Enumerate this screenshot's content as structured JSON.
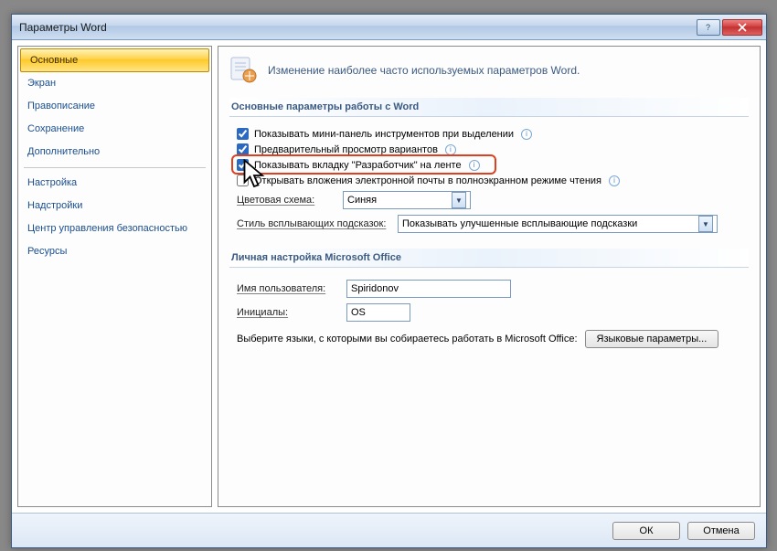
{
  "window": {
    "title": "Параметры Word"
  },
  "sidebar": {
    "items": [
      {
        "label": "Основные",
        "selected": true
      },
      {
        "label": "Экран"
      },
      {
        "label": "Правописание"
      },
      {
        "label": "Сохранение"
      },
      {
        "label": "Дополнительно"
      },
      {
        "label": "Настройка"
      },
      {
        "label": "Надстройки"
      },
      {
        "label": "Центр управления безопасностью"
      },
      {
        "label": "Ресурсы"
      }
    ]
  },
  "main": {
    "header": "Изменение наиболее часто используемых параметров Word.",
    "section1": {
      "title": "Основные параметры работы с Word",
      "chk1": "Показывать мини-панель инструментов при выделении",
      "chk2": "Предварительный просмотр вариантов",
      "chk3": "Показывать вкладку \"Разработчик\" на ленте",
      "chk4": "Открывать вложения электронной почты в полноэкранном режиме чтения",
      "color_scheme_label": "Цветовая схема:",
      "color_scheme_value": "Синяя",
      "tooltip_style_label": "Стиль всплывающих подсказок:",
      "tooltip_style_value": "Показывать улучшенные всплывающие подсказки"
    },
    "section2": {
      "title": "Личная настройка Microsoft Office",
      "username_label": "Имя пользователя:",
      "username_value": "Spiridonov",
      "initials_label": "Инициалы:",
      "initials_value": "OS",
      "lang_prompt": "Выберите языки, с которыми вы собираетесь работать в Microsoft Office:",
      "lang_button": "Языковые параметры..."
    }
  },
  "footer": {
    "ok": "ОК",
    "cancel": "Отмена"
  }
}
